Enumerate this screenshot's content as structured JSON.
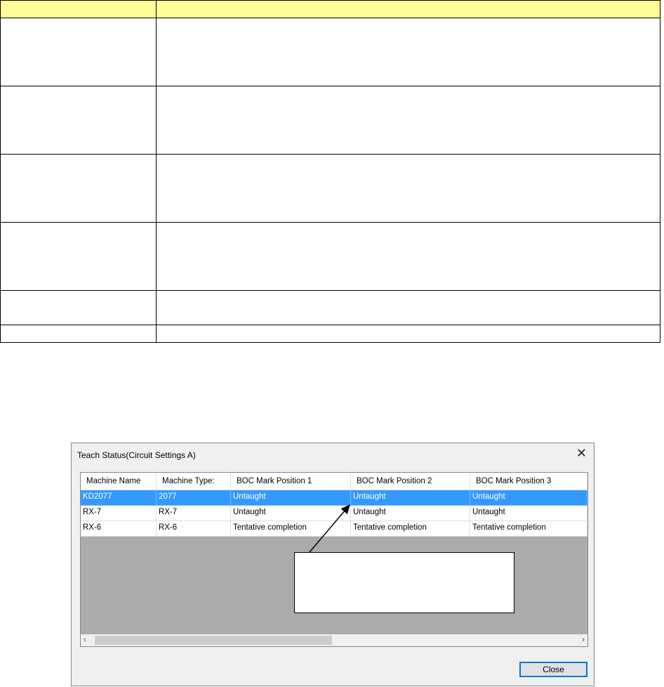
{
  "dialog": {
    "title": "Teach Status(Circuit Settings A)",
    "close_label": "Close",
    "columns": [
      "Machine Name",
      "Machine Type:",
      "BOC Mark Position 1",
      "BOC Mark Position 2",
      "BOC Mark Position 3"
    ],
    "rows": [
      [
        "KD2077",
        "2077",
        "Untaught",
        "Untaught",
        "Untaught"
      ],
      [
        "RX-7",
        "RX-7",
        "Untaught",
        "Untaught",
        "Untaught"
      ],
      [
        "RX-6",
        "RX-6",
        "Tentative completion",
        "Tentative completion",
        "Tentative completion"
      ]
    ]
  },
  "colors": {
    "header_bg": "#ffff99",
    "selection": "#3399ff"
  }
}
